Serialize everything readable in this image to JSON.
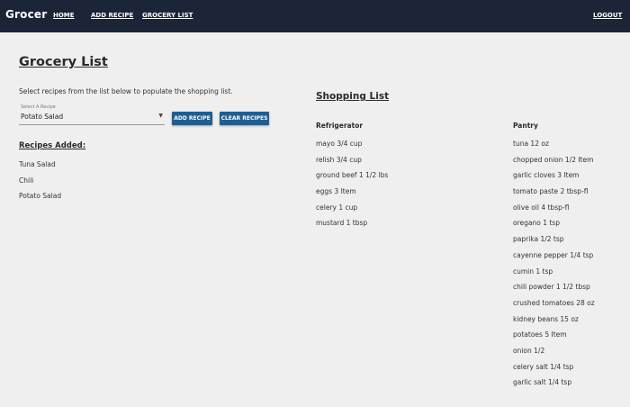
{
  "nav": {
    "brand": "Grocer",
    "home": "HOME",
    "add_recipe": "ADD RECIPE",
    "grocery_list": "GROCERY LIST",
    "logout": "LOGOUT"
  },
  "page": {
    "title": "Grocery List",
    "instructions": "Select recipes from the list below to populate the shopping list."
  },
  "recipe_select": {
    "label": "Select A Recipe",
    "value": "Potato Salad",
    "arrow_icon": "caret-down-icon"
  },
  "buttons": {
    "add_recipe": "ADD RECIPE",
    "clear_recipes": "CLEAR RECIPES"
  },
  "recipes_added": {
    "heading": "Recipes Added:",
    "items": [
      "Tuna Salad",
      "Chili",
      "Potato Salad"
    ]
  },
  "shopping_list": {
    "heading": "Shopping List",
    "refrigerator": {
      "heading": "Refrigerator",
      "items": [
        "mayo 3/4 cup",
        "relish 3/4 cup",
        "ground beef 1 1/2 lbs",
        "eggs 3 Item",
        "celery 1 cup",
        "mustard 1 tbsp"
      ]
    },
    "pantry": {
      "heading": "Pantry",
      "items": [
        "tuna 12 oz",
        "chopped onion 1/2 Item",
        "garlic cloves 3 Item",
        "tomato paste 2 tbsp-fl",
        "olive oil 4 tbsp-fl",
        "oregano 1 tsp",
        "paprika 1/2 tsp",
        "cayenne pepper 1/4 tsp",
        "cumin 1 tsp",
        "chili powder 1 1/2 tbsp",
        "crushed tomatoes 28 oz",
        "kidney beans 15 oz",
        "potatoes 5 Item",
        "onion 1/2",
        "celery salt 1/4 tsp",
        "garlic salt 1/4 tsp"
      ]
    }
  },
  "colors": {
    "navbar": "#1c2538",
    "button": "#1d5f94",
    "background": "#efefef"
  }
}
